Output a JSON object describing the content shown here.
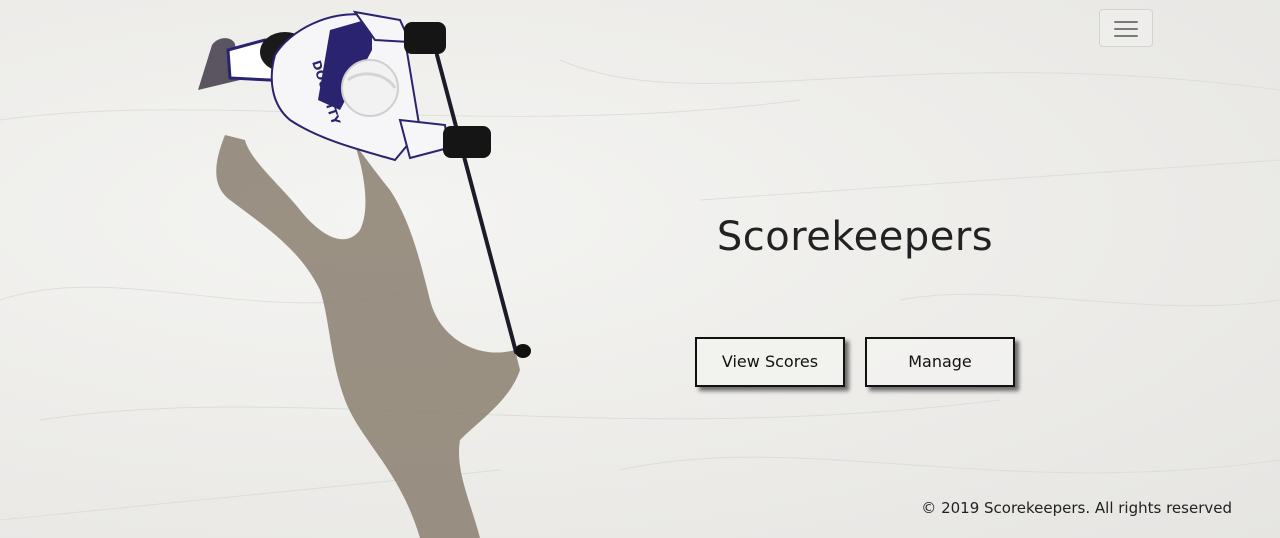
{
  "nav": {
    "menu_icon": "hamburger-menu-icon"
  },
  "hero": {
    "title": "Scorekeepers",
    "background": "hockey-player-on-ice-photo",
    "player_jersey_text": "DOUGHTY"
  },
  "actions": {
    "view_scores_label": "View Scores",
    "manage_label": "Manage"
  },
  "footer": {
    "copyright": "© 2019 Scorekeepers. All rights reserved"
  },
  "colors": {
    "ice": "#eeeeec",
    "text": "#222222",
    "button_border": "#111111",
    "jersey_accent": "#2a2470"
  }
}
